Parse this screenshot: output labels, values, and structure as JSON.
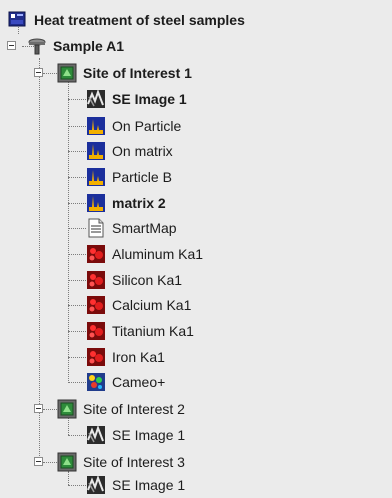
{
  "tree": {
    "root": {
      "label": "Heat treatment of steel samples",
      "icon": "project-icon"
    },
    "sample": {
      "label": "Sample A1",
      "icon": "sample-stub-icon"
    },
    "site1": {
      "label": "Site of Interest 1",
      "icon": "site-icon",
      "children": [
        {
          "label": "SE Image 1",
          "icon": "se-image-icon",
          "bold": true
        },
        {
          "label": "On Particle",
          "icon": "spectrum-icon",
          "bold": false
        },
        {
          "label": "On matrix",
          "icon": "spectrum-icon",
          "bold": false
        },
        {
          "label": "Particle B",
          "icon": "spectrum-icon",
          "bold": false
        },
        {
          "label": "matrix 2",
          "icon": "spectrum-icon",
          "bold": true
        },
        {
          "label": "SmartMap",
          "icon": "smartmap-icon",
          "bold": false
        },
        {
          "label": "Aluminum Ka1",
          "icon": "element-map-icon",
          "bold": false
        },
        {
          "label": "Silicon Ka1",
          "icon": "element-map-icon",
          "bold": false
        },
        {
          "label": "Calcium Ka1",
          "icon": "element-map-icon",
          "bold": false
        },
        {
          "label": "Titanium Ka1",
          "icon": "element-map-icon",
          "bold": false
        },
        {
          "label": "Iron Ka1",
          "icon": "element-map-icon",
          "bold": false
        },
        {
          "label": "Cameo+",
          "icon": "cameo-icon",
          "bold": false
        }
      ]
    },
    "site2": {
      "label": "Site of Interest 2",
      "icon": "site-icon",
      "child": "SE Image 1"
    },
    "site3": {
      "label": "Site of Interest 3",
      "icon": "site-icon",
      "child": "SE Image 1"
    }
  }
}
